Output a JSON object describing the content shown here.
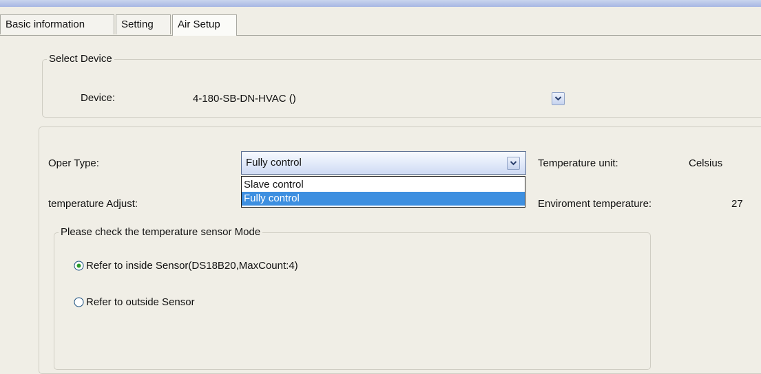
{
  "tabs": [
    {
      "label": "Basic information"
    },
    {
      "label": "Setting"
    },
    {
      "label": "Air Setup"
    }
  ],
  "select_device": {
    "legend": "Select Device",
    "device_label": "Device:",
    "device_value": "4-180-SB-DN-HVAC ()"
  },
  "main": {
    "oper_type_label": "Oper Type:",
    "oper_type_value": "Fully control",
    "oper_type_options": [
      "Slave control",
      "Fully control"
    ],
    "temperature_adjust_label": "temperature Adjust:",
    "temperature_unit_label": "Temperature unit:",
    "temperature_unit_value": "Celsius",
    "environment_temp_label": "Enviroment temperature:",
    "environment_temp_value": "27"
  },
  "sensor_mode": {
    "legend": "Please check the temperature sensor Mode",
    "option_inside": "Refer to inside Sensor(DS18B20,MaxCount:4)",
    "option_outside": "Refer to outside Sensor"
  },
  "colors": {
    "selection": "#3d8fe0",
    "window_bg": "#f0eee6"
  }
}
